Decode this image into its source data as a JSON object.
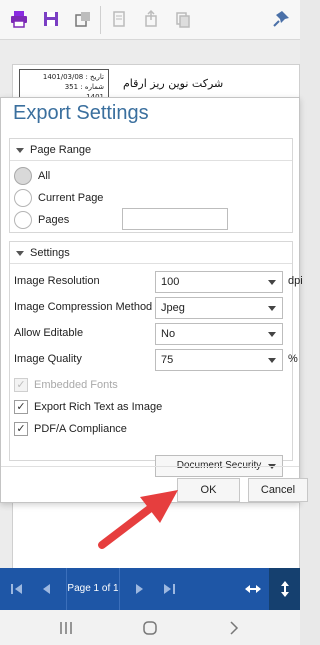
{
  "toolbar": {
    "icons": [
      "print-icon",
      "save-icon",
      "export-icon",
      "document-icon",
      "share-icon",
      "copy-icon",
      "pin-icon"
    ]
  },
  "document": {
    "date_line": "تاریخ : 1401/03/08",
    "number_line": "شماره : 351",
    "extra_line": "1401",
    "company_title": "شرکت نوین ریز ارقام"
  },
  "dialog": {
    "title": "Export Settings",
    "page_range": {
      "header": "Page Range",
      "options": [
        "All",
        "Current Page",
        "Pages"
      ],
      "selected": "All",
      "pages_value": ""
    },
    "settings": {
      "header": "Settings",
      "image_resolution": {
        "label": "Image Resolution",
        "value": "100",
        "unit": "dpi"
      },
      "compression": {
        "label": "Image Compression Method",
        "value": "Jpeg"
      },
      "allow_editable": {
        "label": "Allow Editable",
        "value": "No"
      },
      "image_quality": {
        "label": "Image Quality",
        "value": "75",
        "unit": "%"
      },
      "embedded_fonts": {
        "label": "Embedded Fonts",
        "checked": true,
        "disabled": true
      },
      "export_rich_text": {
        "label": "Export Rich Text as Image",
        "checked": true
      },
      "pdfa": {
        "label": "PDF/A Compliance",
        "checked": true
      },
      "document_security": "Document Security"
    },
    "ok_label": "OK",
    "cancel_label": "Cancel"
  },
  "navbar": {
    "page_label": "Page 1 of 1"
  },
  "colors": {
    "accent": "#3a6f9e",
    "navbar": "#1e56a6",
    "arrow": "#e63e3e"
  }
}
